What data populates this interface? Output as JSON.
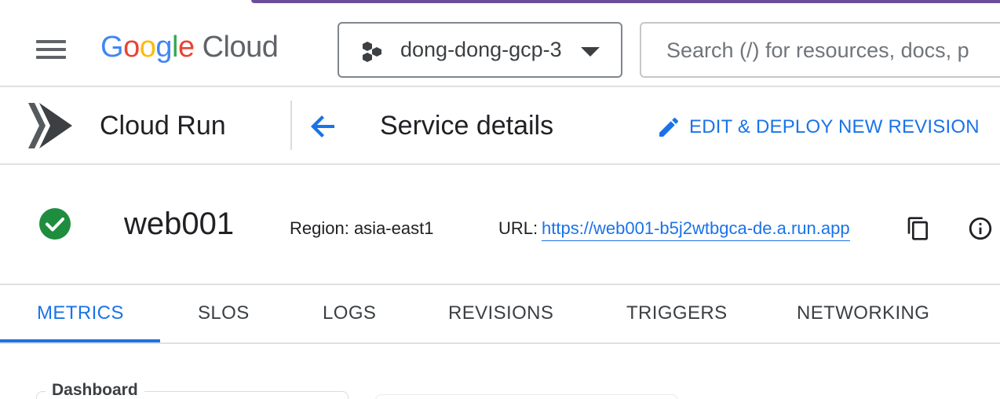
{
  "header": {
    "logo_text": "Google",
    "logo_product": "Cloud",
    "project_name": "dong-dong-gcp-3",
    "search_placeholder": "Search (/) for resources, docs, p"
  },
  "service_bar": {
    "product_name": "Cloud Run",
    "page_title": "Service details",
    "edit_deploy_label": "EDIT & DEPLOY NEW REVISION"
  },
  "service": {
    "name": "web001",
    "region_text": "Region: asia-east1",
    "url_label": "URL:",
    "url": "https://web001-b5j2wtbgca-de.a.run.app",
    "status": "ok"
  },
  "tabs": [
    {
      "label": "METRICS",
      "active": true
    },
    {
      "label": "SLOS",
      "active": false
    },
    {
      "label": "LOGS",
      "active": false
    },
    {
      "label": "REVISIONS",
      "active": false
    },
    {
      "label": "TRIGGERS",
      "active": false
    },
    {
      "label": "NETWORKING",
      "active": false
    }
  ],
  "dashboard": {
    "label": "Dashboard"
  },
  "colors": {
    "accent_blue": "#1a73e8",
    "status_green": "#1e8e3e",
    "top_accent": "#6b4e9b"
  }
}
